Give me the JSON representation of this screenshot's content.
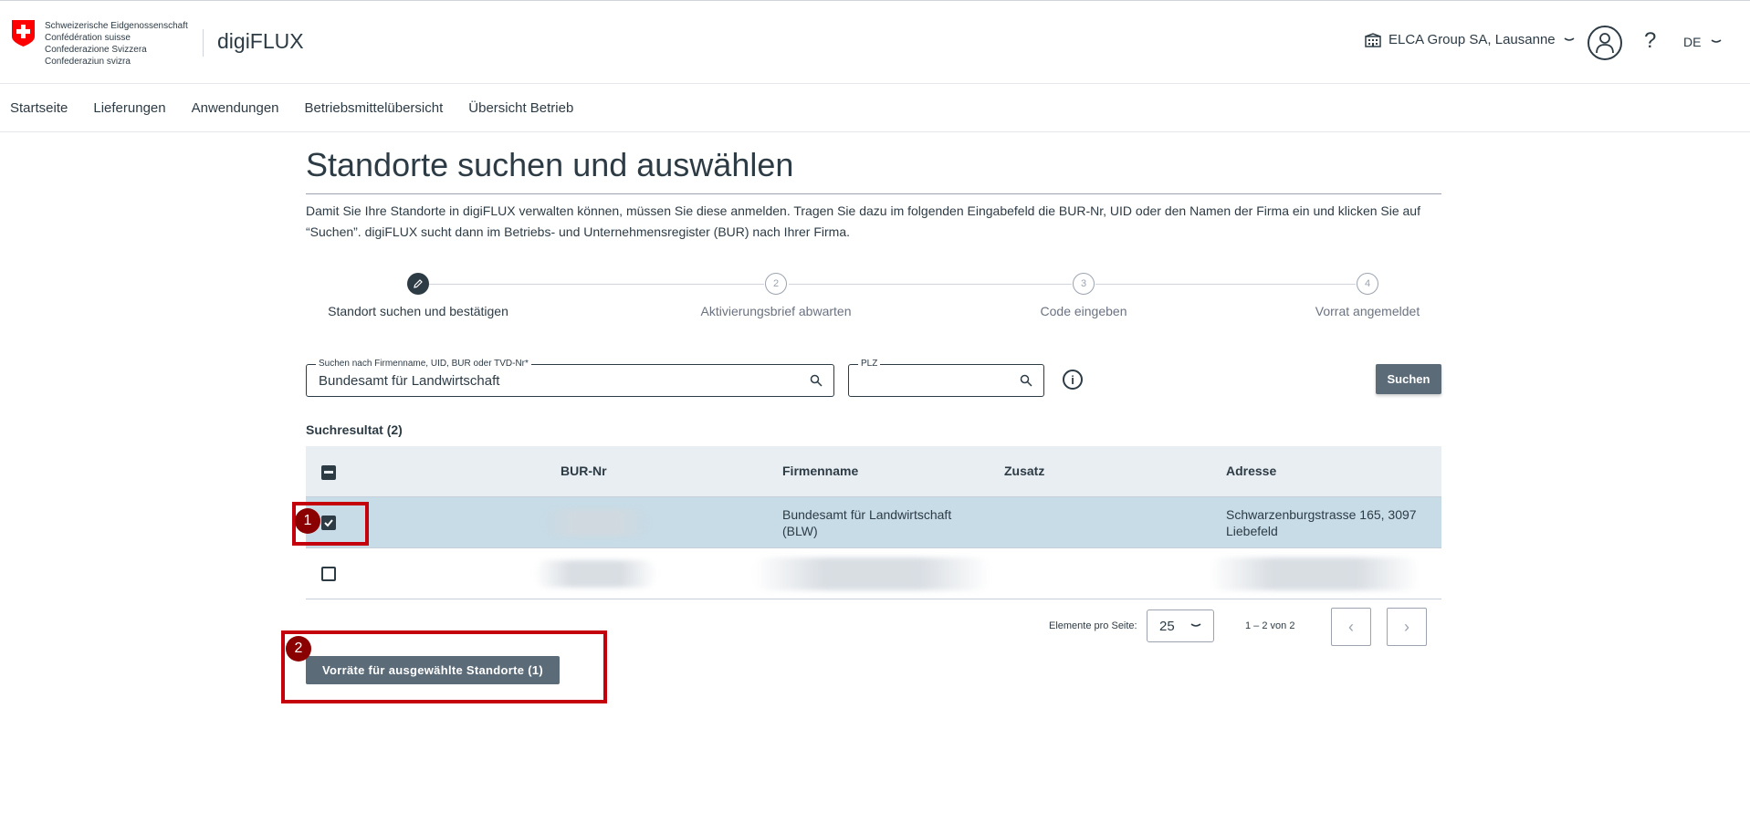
{
  "header": {
    "logo_lines": [
      "Schweizerische Eidgenossenschaft",
      "Confédération suisse",
      "Confederazione Svizzera",
      "Confederaziun svizra"
    ],
    "app_name": "digiFLUX",
    "org_name": "ELCA Group SA, Lausanne",
    "help": "?",
    "language": "DE"
  },
  "nav": {
    "items": [
      "Startseite",
      "Lieferungen",
      "Anwendungen",
      "Betriebsmittelübersicht",
      "Übersicht Betrieb"
    ]
  },
  "page": {
    "title": "Standorte suchen und auswählen",
    "description_1": "Damit Sie Ihre Standorte in digiFLUX verwalten können, müssen Sie diese anmelden. Tragen Sie dazu im folgenden Eingabefeld die BUR-Nr, UID oder den Namen der Firma ein und klicken Sie auf",
    "description_2": "“Suchen”. digiFLUX sucht dann im Betriebs- und Unternehmensregister (BUR) nach Ihrer Firma."
  },
  "stepper": {
    "steps": [
      {
        "number": "1",
        "label": "Standort suchen und bestätigen",
        "state": "active"
      },
      {
        "number": "2",
        "label": "Aktivierungsbrief abwarten",
        "state": "todo"
      },
      {
        "number": "3",
        "label": "Code eingeben",
        "state": "todo"
      },
      {
        "number": "4",
        "label": "Vorrat angemeldet",
        "state": "todo"
      }
    ]
  },
  "search": {
    "query_label": "Suchen nach Firmenname, UID, BUR oder TVD-Nr*",
    "query_value": "Bundesamt für Landwirtschaft",
    "plz_label": "PLZ",
    "plz_value": "",
    "info_icon": "i",
    "button_label": "Suchen"
  },
  "results": {
    "count_label": "Suchresultat (2)",
    "columns": [
      "BUR-Nr",
      "Firmenname",
      "Zusatz",
      "Adresse"
    ],
    "rows": [
      {
        "selected": true,
        "bur": "",
        "name_1": "Bundesamt für Landwirtschaft",
        "name_2": "(BLW)",
        "zusatz": "",
        "address_1": "Schwarzenburgstrasse 165, 3097",
        "address_2": "Liebefeld"
      },
      {
        "selected": false,
        "bur": "",
        "name_1": "",
        "name_2": "",
        "zusatz": "",
        "address_1": "",
        "address_2": ""
      }
    ]
  },
  "pagination": {
    "per_page_label": "Elemente pro Seite:",
    "per_page_value": "25",
    "range": "1 – 2 von 2",
    "prev": "‹",
    "next": "›"
  },
  "actions": {
    "primary_label": "Vorräte für ausgewählte Standorte (1)"
  },
  "annotations": [
    {
      "number": "1",
      "color": "#c4000d"
    },
    {
      "number": "2",
      "color": "#c4000d"
    }
  ],
  "colors": {
    "primary": "#2d3b45",
    "button": "#5b6b78",
    "header_row": "#e9eef2",
    "selected_row": "#c7dce7",
    "annotation": "#c4000d",
    "swiss_red": "#ff0000"
  }
}
